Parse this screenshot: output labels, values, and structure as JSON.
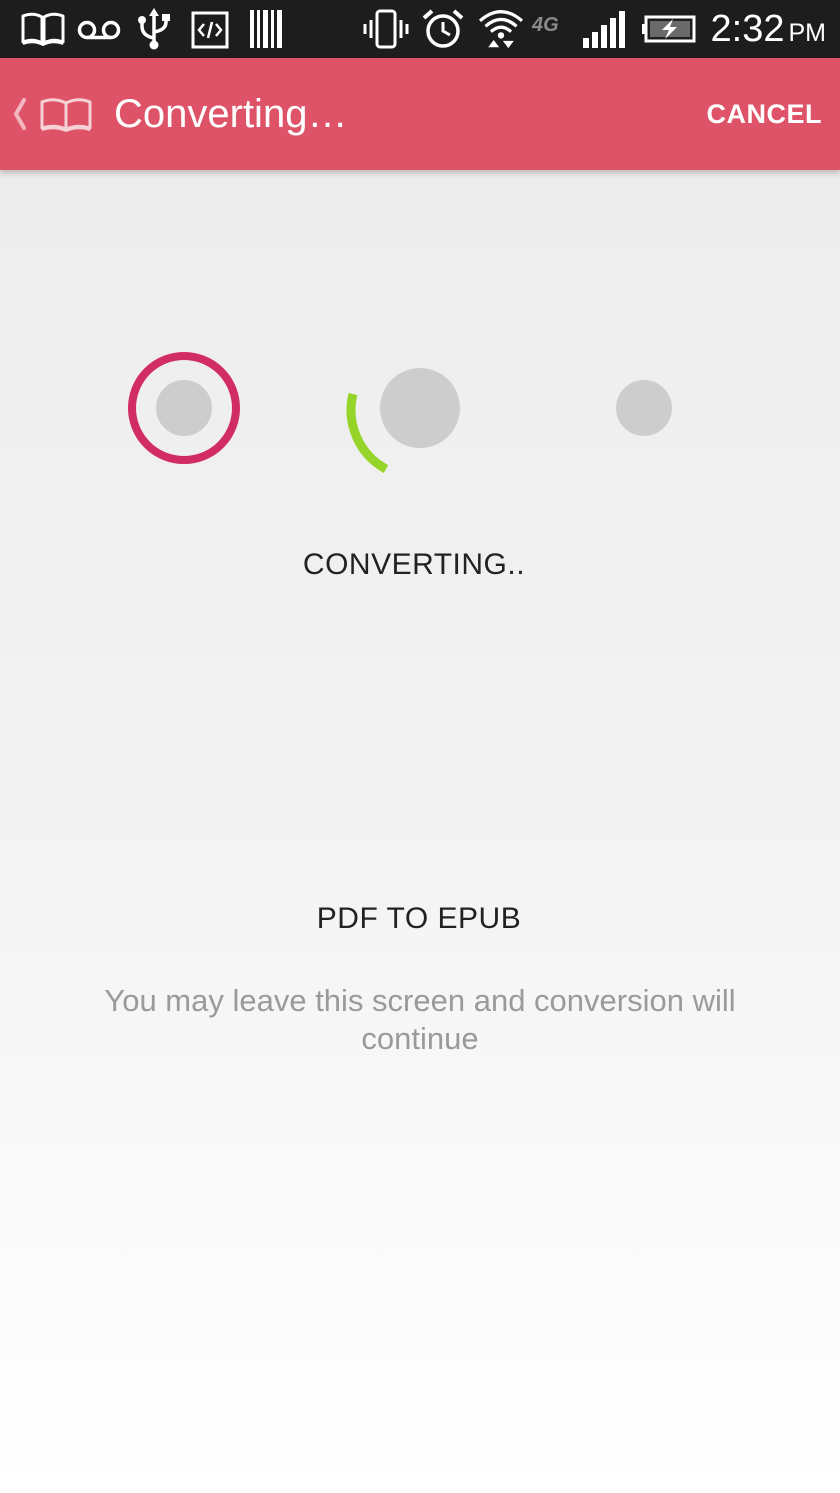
{
  "status_bar": {
    "time": "2:32",
    "ampm": "PM",
    "network_label": "4G",
    "icons": [
      "book-notification-icon",
      "voicemail-icon",
      "usb-icon",
      "developer-code-icon",
      "barcode-icon",
      "vibrate-icon",
      "alarm-icon",
      "wifi-icon",
      "network-4g-icon",
      "signal-icon",
      "battery-charging-icon"
    ]
  },
  "action_bar": {
    "title": "Converting…",
    "cancel_label": "CANCEL",
    "icons": [
      "back-chevron-icon",
      "book-logo-icon"
    ]
  },
  "progress": {
    "status_label": "CONVERTING..",
    "format_label": "PDF TO EPUB",
    "hint": "You may leave this screen and conversion will continue",
    "steps": [
      {
        "state": "done",
        "ring_color": "#d12c63"
      },
      {
        "state": "active",
        "spinner_color": "#96d42a"
      },
      {
        "state": "pending"
      }
    ]
  },
  "colors": {
    "action_bar": "#de5368",
    "status_bar": "#1d1d1d",
    "step_dot": "#cdcdcd",
    "ring": "#d12c63",
    "spinner": "#96d42a"
  }
}
